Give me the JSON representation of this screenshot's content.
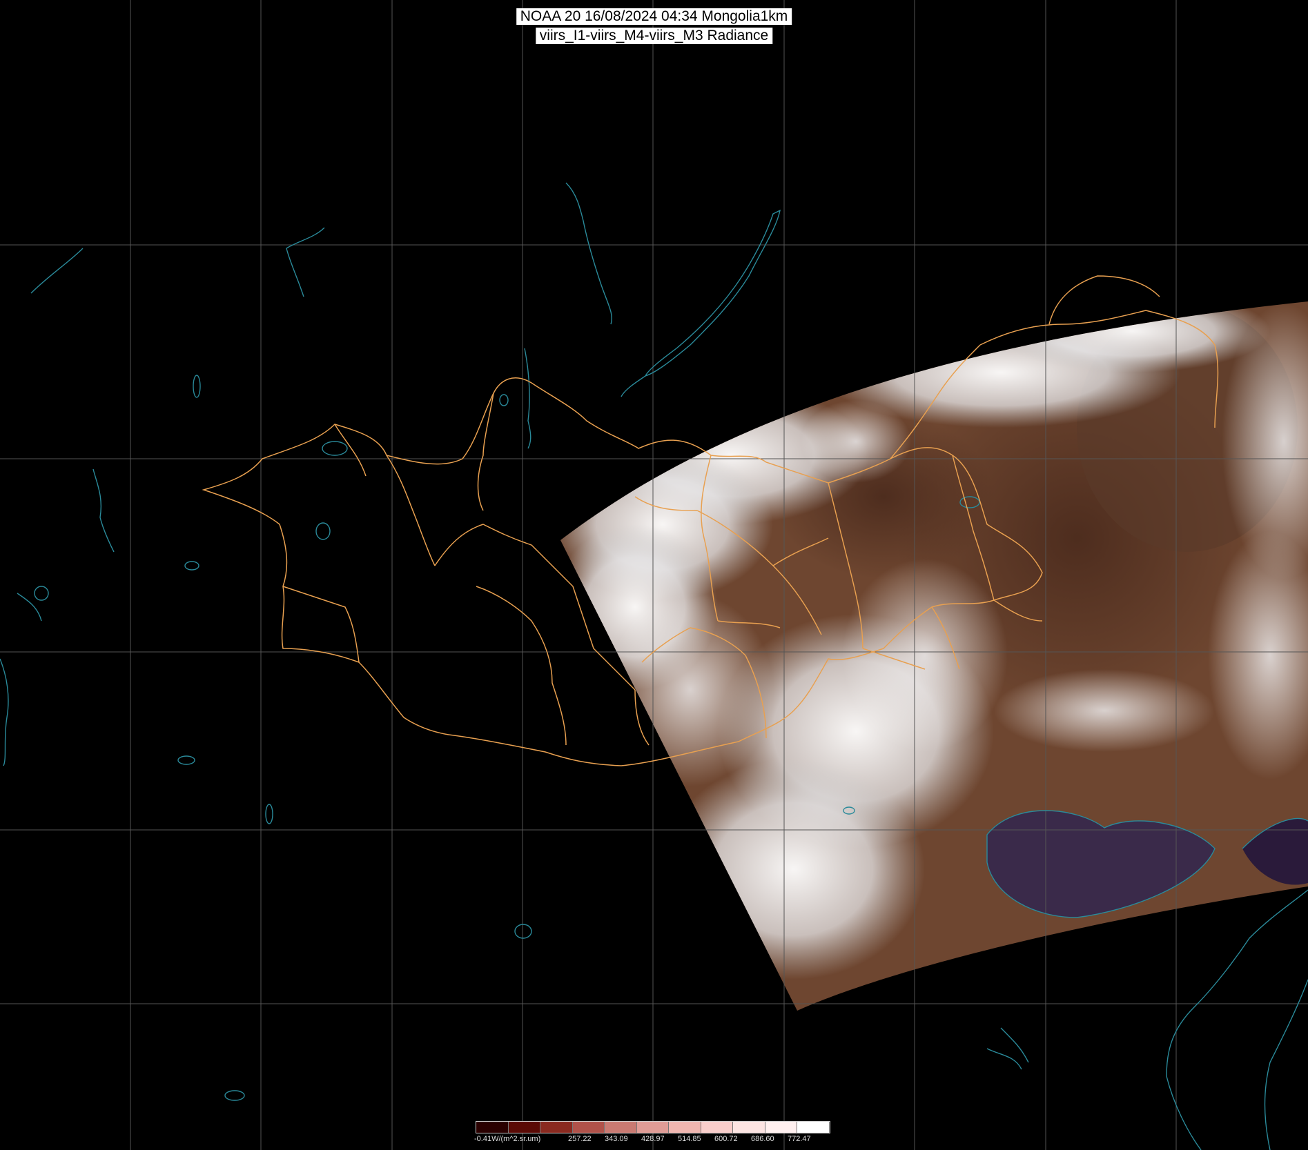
{
  "title": {
    "line1": "NOAA 20 16/08/2024 04:34 Mongolia1km",
    "line2": "viirs_I1-viirs_M4-viirs_M3 Radiance"
  },
  "colorbar": {
    "unit_label": "-0.41W/(m^2.sr.um)",
    "ticks": [
      "257.22",
      "343.09",
      "428.97",
      "514.85",
      "600.72",
      "686.60",
      "772.47"
    ],
    "colors": [
      "#2a0000",
      "#5a0a05",
      "#8a2a20",
      "#b0524a",
      "#c97a72",
      "#e09c96",
      "#f0b6b0",
      "#f8cecb",
      "#fce4e2",
      "#fff0ef",
      "#ffffff"
    ]
  },
  "colors": {
    "background": "#000000",
    "graticule": "#555555",
    "borders": "#e8a050",
    "coastlines": "#2a8a9a",
    "swath_land": "#6e4630",
    "swath_cloud": "#eeeeee",
    "sea": "#3a2a4a"
  }
}
